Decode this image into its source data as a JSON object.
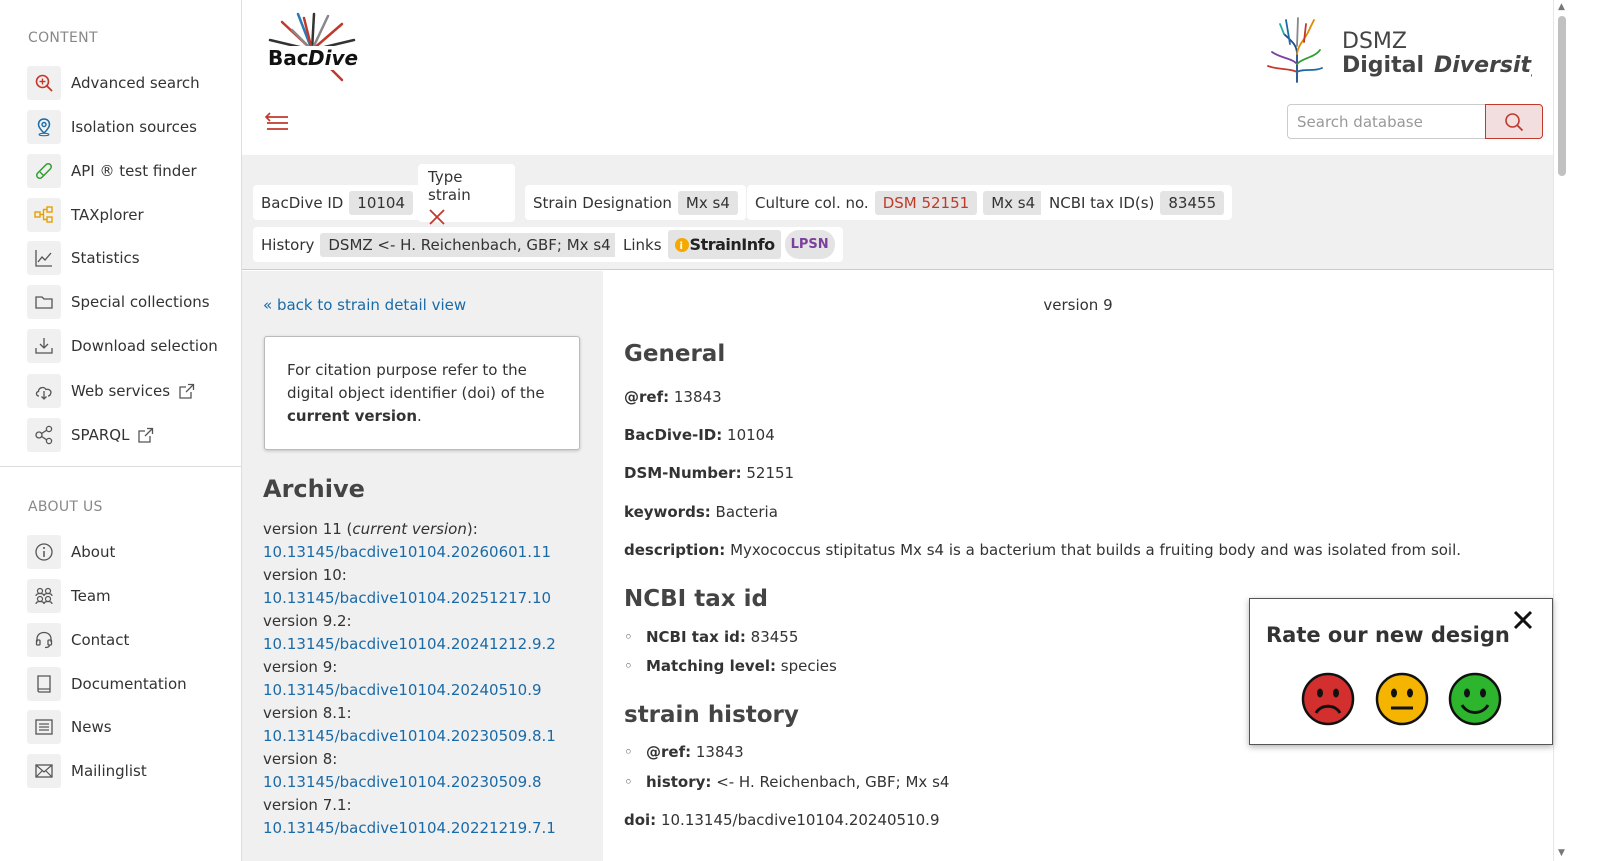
{
  "sidebar": {
    "content_heading": "CONTENT",
    "content_items": [
      {
        "label": "Advanced search",
        "icon": "magnifier-plus-icon"
      },
      {
        "label": "Isolation sources",
        "icon": "map-pin-icon"
      },
      {
        "label": "API ® test finder",
        "icon": "test-tube-icon"
      },
      {
        "label": "TAXplorer",
        "icon": "taxonomy-tree-icon"
      },
      {
        "label": "Statistics",
        "icon": "line-chart-icon"
      },
      {
        "label": "Special collections",
        "icon": "folder-icon"
      },
      {
        "label": "Download selection",
        "icon": "download-tray-icon"
      },
      {
        "label": "Web services",
        "icon": "cloud-download-icon",
        "external": true
      },
      {
        "label": "SPARQL",
        "icon": "share-nodes-icon",
        "external": true
      }
    ],
    "about_heading": "ABOUT US",
    "about_items": [
      {
        "label": "About",
        "icon": "info-circle-icon"
      },
      {
        "label": "Team",
        "icon": "people-icon"
      },
      {
        "label": "Contact",
        "icon": "headset-icon"
      },
      {
        "label": "Documentation",
        "icon": "book-icon"
      },
      {
        "label": "News",
        "icon": "newspaper-icon"
      },
      {
        "label": "Mailinglist",
        "icon": "envelope-icon"
      }
    ]
  },
  "header": {
    "logo_text_1": "Bac",
    "logo_text_2": "Dive",
    "partner_line1": "DSMZ",
    "partner_line2a": "Digital",
    "partner_line2b": "Diversity",
    "search_placeholder": "Search database"
  },
  "infobar": {
    "bacdive_id_label": "BacDive ID",
    "bacdive_id": "10104",
    "type_strain_label": "Type strain",
    "strain_designation_label": "Strain Designation",
    "strain_designation": "Mx s4",
    "culture_col_label": "Culture col. no.",
    "culture_col_1": "DSM 52151",
    "culture_col_2": "Mx s4",
    "ncbi_label": "NCBI tax ID(s)",
    "ncbi_id": "83455",
    "history_label": "History",
    "history": "DSMZ <- H. Reichenbach, GBF; Mx s4",
    "links_label": "Links",
    "straininfo": "StrainInfo",
    "lpsn": "LPSN"
  },
  "left": {
    "back_link": "« back to strain detail view",
    "cite_text_1": "For citation purpose refer to the digital object identifier (doi) of the ",
    "cite_text_bold": "current version",
    "cite_text_2": ".",
    "archive_title": "Archive",
    "archive": [
      {
        "version": "version 11 (",
        "current": "current version",
        "suffix": "):",
        "doi": "10.13145/bacdive10104.20260601.11"
      },
      {
        "version": "version 10:",
        "doi": "10.13145/bacdive10104.20251217.10"
      },
      {
        "version": "version 9.2:",
        "doi": "10.13145/bacdive10104.20241212.9.2"
      },
      {
        "version": "version 9:",
        "doi": "10.13145/bacdive10104.20240510.9"
      },
      {
        "version": "version 8.1:",
        "doi": "10.13145/bacdive10104.20230509.8.1"
      },
      {
        "version": "version 8:",
        "doi": "10.13145/bacdive10104.20230509.8"
      },
      {
        "version": "version 7.1:",
        "doi": "10.13145/bacdive10104.20221219.7.1"
      }
    ]
  },
  "main": {
    "version_label": "version 9",
    "general_title": "General",
    "ref_label": "@ref:",
    "ref_value": "13843",
    "bacdive_id_label": "BacDive-ID:",
    "bacdive_id_value": "10104",
    "dsm_label": "DSM-Number:",
    "dsm_value": "52151",
    "keywords_label": "keywords:",
    "keywords_value": "Bacteria",
    "description_label": "description:",
    "description_value": "Myxococcus stipitatus Mx s4 is a bacterium that builds a fruiting body and was isolated from soil.",
    "ncbi_title": "NCBI tax id",
    "ncbi_taxid_label": "NCBI tax id:",
    "ncbi_taxid_value": "83455",
    "matching_label": "Matching level:",
    "matching_value": "species",
    "history_title": "strain history",
    "hist_ref_label": "@ref:",
    "hist_ref_value": "13843",
    "hist_label": "history:",
    "hist_value": "<- H. Reichenbach, GBF; Mx s4",
    "doi_label": "doi:",
    "doi_value": "10.13145/bacdive10104.20240510.9"
  },
  "rating": {
    "title": "Rate our new design",
    "faces": [
      "sad-face-icon",
      "neutral-face-icon",
      "happy-face-icon"
    ],
    "colors": {
      "sad": "#d32f2f",
      "neutral": "#f5b400",
      "happy": "#2db52d"
    }
  },
  "colors": {
    "link": "#1a6aa8",
    "accent_red": "#c0392b"
  }
}
